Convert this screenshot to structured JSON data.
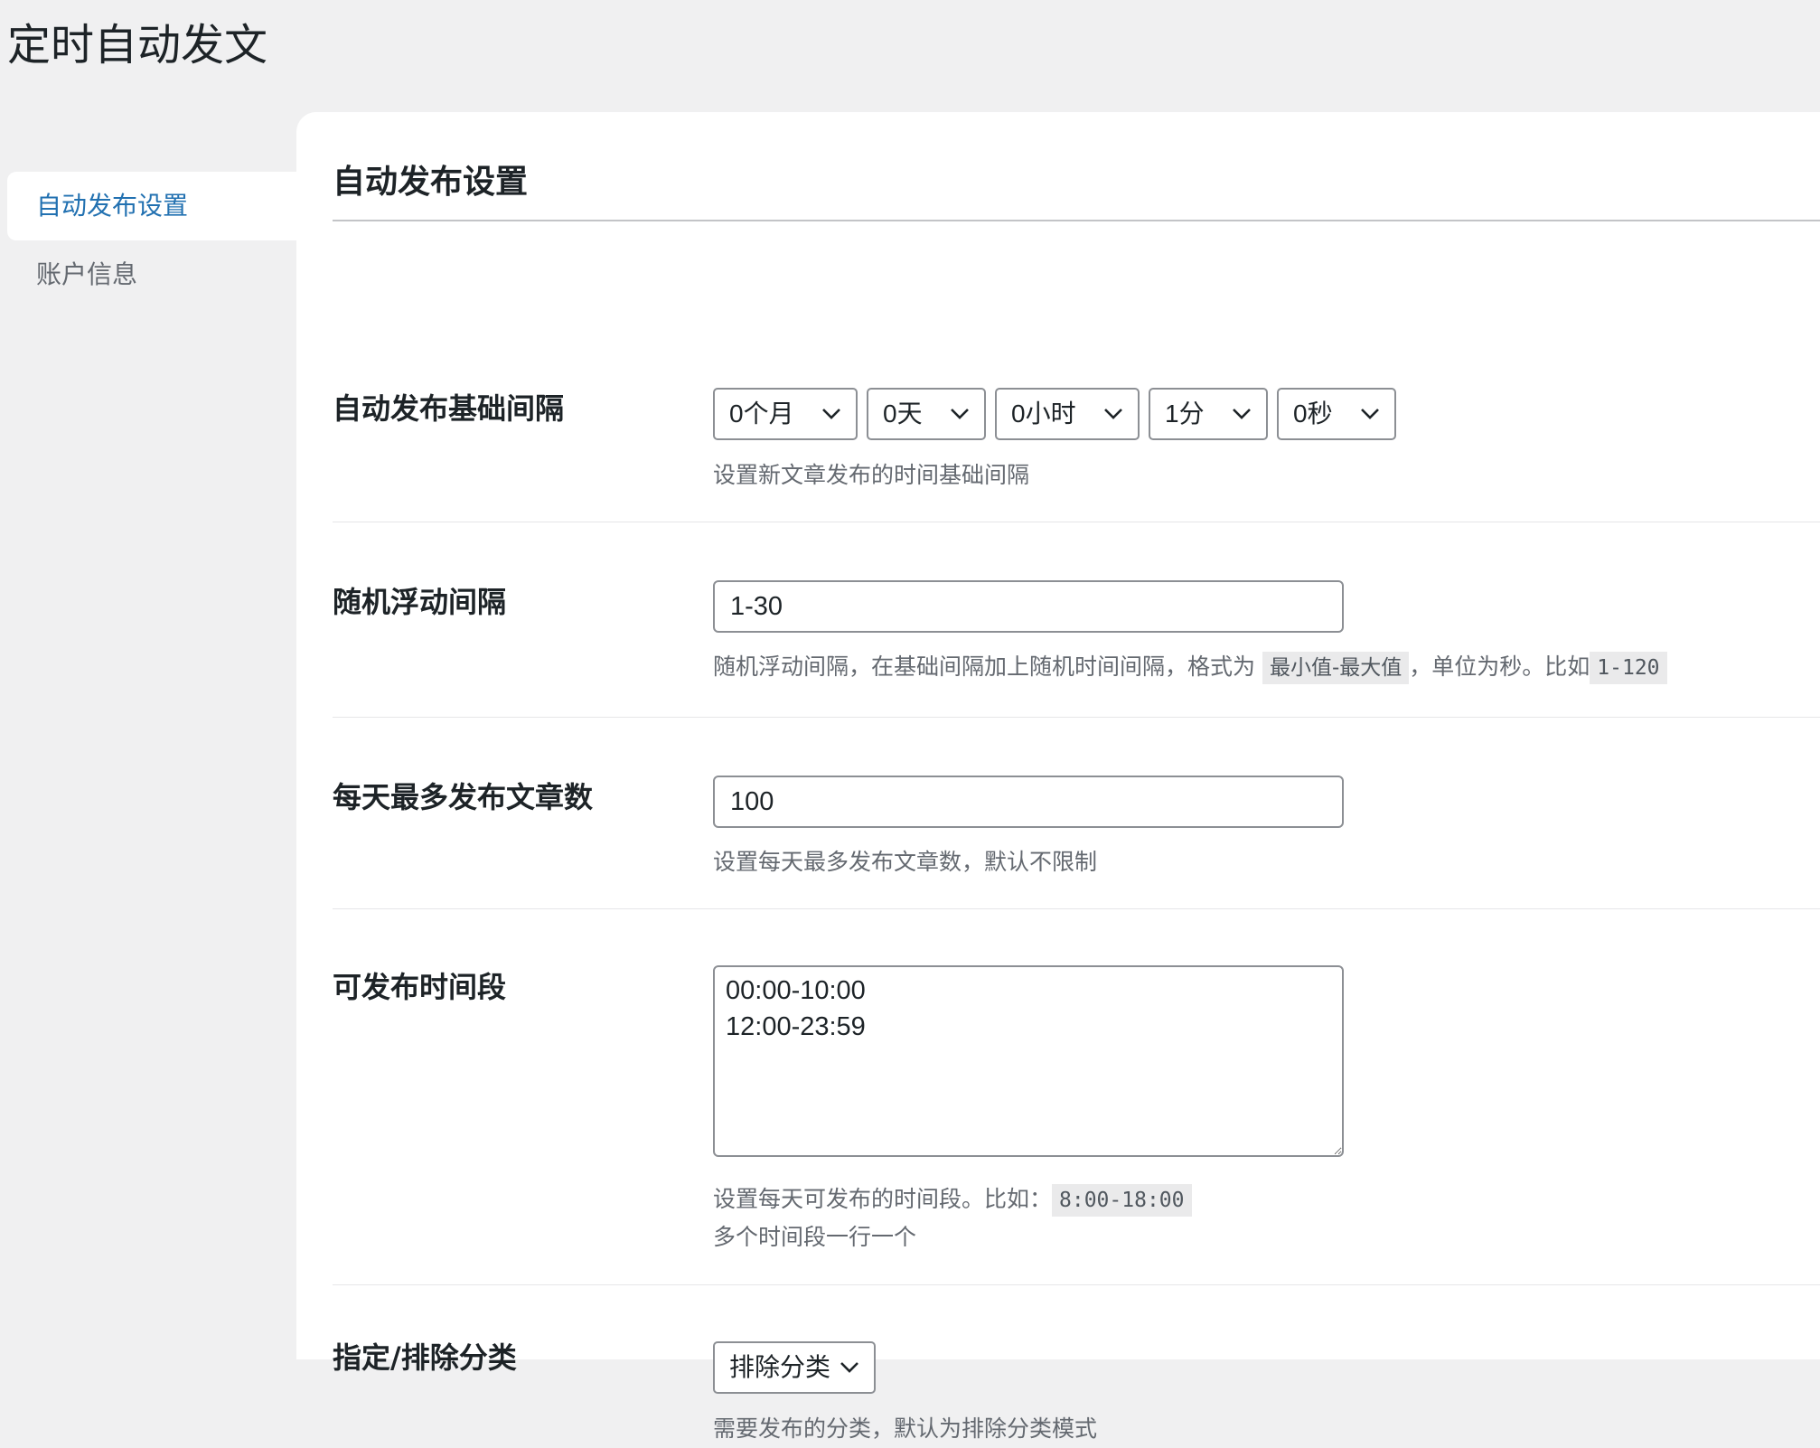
{
  "page": {
    "title": "定时自动发文"
  },
  "sidebar": {
    "items": [
      {
        "label": "自动发布设置",
        "active": true
      },
      {
        "label": "账户信息",
        "active": false
      }
    ]
  },
  "section": {
    "title": "自动发布设置"
  },
  "base_interval": {
    "label": "自动发布基础间隔",
    "selects": [
      "0个月",
      "0天",
      "0小时",
      "1分",
      "0秒"
    ],
    "description": "设置新文章发布的时间基础间隔"
  },
  "random_interval": {
    "label": "随机浮动间隔",
    "value": "1-30",
    "description_prefix": "随机浮动间隔，在基础间隔加上随机时间间隔，格式为",
    "description_code": "最小值-最大值",
    "description_middle": "，单位为秒。比如",
    "description_example": "1-120"
  },
  "daily_max": {
    "label": "每天最多发布文章数",
    "value": "100",
    "description": "设置每天最多发布文章数，默认不限制"
  },
  "time_ranges": {
    "label": "可发布时间段",
    "value": "00:00-10:00\n12:00-23:59",
    "description_prefix": "设置每天可发布的时间段。比如：",
    "description_example": "8:00-18:00",
    "description_line2": "多个时间段一行一个"
  },
  "category": {
    "label": "指定/排除分类",
    "select_value": "排除分类",
    "description": "需要发布的分类，默认为排除分类模式"
  },
  "colors": {
    "background": "#f0f0f1",
    "panel": "#ffffff",
    "accent": "#2271b1",
    "muted_text": "#646970",
    "border": "#8c8f94"
  }
}
